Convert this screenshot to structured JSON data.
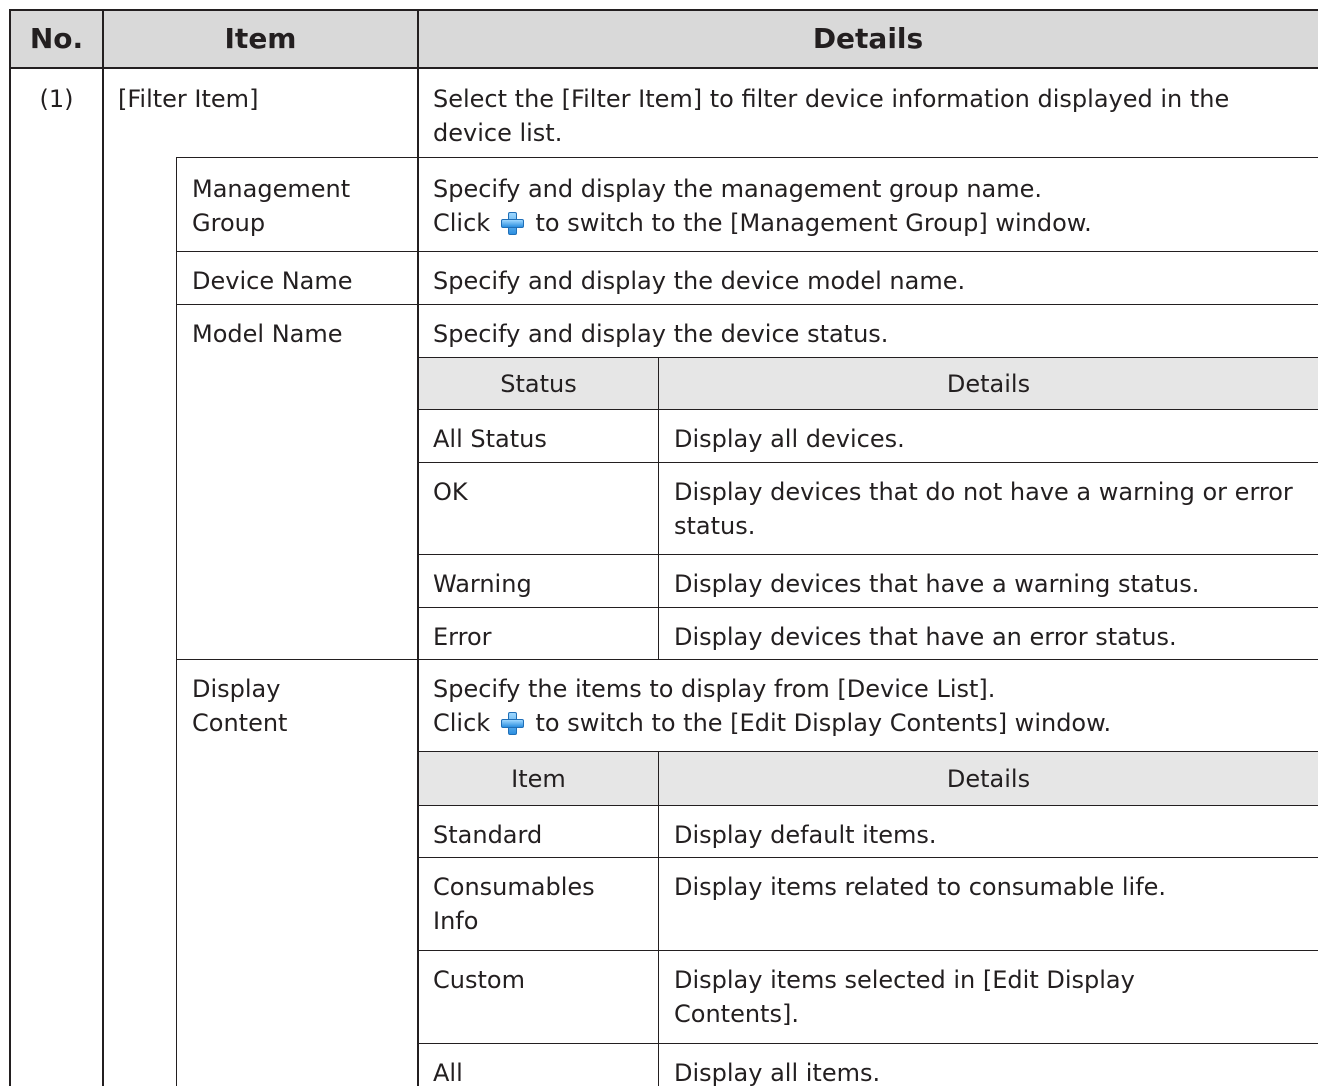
{
  "header": {
    "no": "No.",
    "item": "Item",
    "details": "Details"
  },
  "row1": {
    "no": "(1)",
    "item": "[Filter Item]",
    "details": "Select the [Filter Item] to filter device information displayed in the device list."
  },
  "management_group": {
    "label": "Management Group",
    "line1": "Specify and display the management group name.",
    "pre": "Click",
    "post": "to switch to the [Management Group] window."
  },
  "device_name": {
    "label": "Device Name",
    "details": "Specify and display the device model name."
  },
  "model_name": {
    "label": "Model Name",
    "details": "Specify and display the device status."
  },
  "status_table": {
    "headers": [
      "Status",
      "Details"
    ],
    "rows": [
      [
        "All Status",
        "Display all devices."
      ],
      [
        "OK",
        "Display devices that do not have a warning or error status."
      ],
      [
        "Warning",
        "Display devices that have a warning status."
      ],
      [
        "Error",
        "Display devices that have an error status."
      ]
    ]
  },
  "display_content": {
    "label": "Display Content",
    "line1": "Specify the items to display from [Device List].",
    "pre": "Click",
    "post": "to switch to the [Edit Display Contents] window."
  },
  "content_table": {
    "headers": [
      "Item",
      "Details"
    ],
    "rows": [
      [
        "Standard",
        "Display default items."
      ],
      [
        "Consumables Info",
        "Display items related to consumable life."
      ],
      [
        "Custom",
        "Display items selected in [Edit Display Contents]."
      ],
      [
        "All",
        "Display all items."
      ]
    ]
  },
  "icons": {
    "add": "plus-icon"
  }
}
